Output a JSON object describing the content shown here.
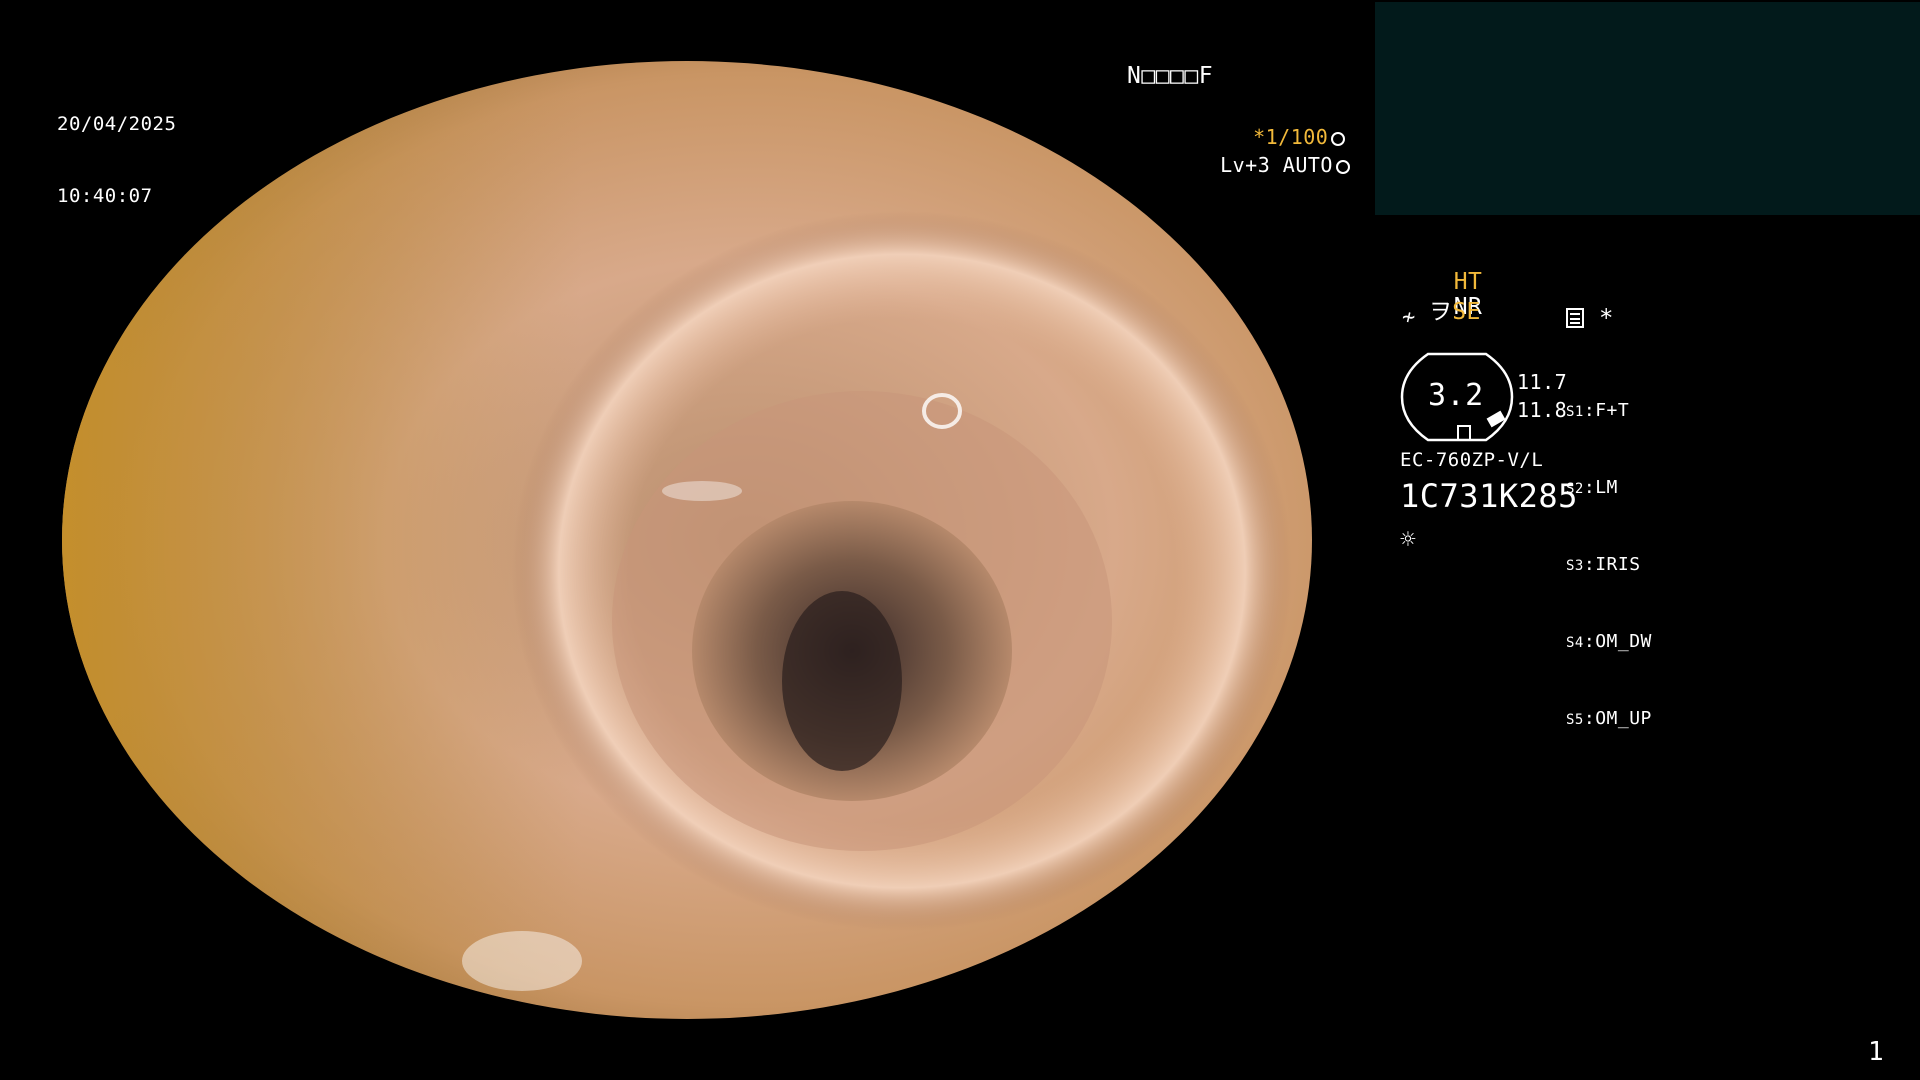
{
  "datetime": {
    "date": "20/04/2025",
    "time": "10:40:07"
  },
  "patient_code": "N□□□□F",
  "shutter": {
    "value": "*1/100",
    "icon": "aperture-icon"
  },
  "iris": {
    "value": "Lv+3 AUTO",
    "icon": "iris-icon"
  },
  "modes": {
    "ht": "HT",
    "nr": "NR",
    "se": "SE"
  },
  "icons": {
    "filter": "filter-icon",
    "scope": "scope-shape-icon",
    "memory": "memory-icon",
    "star": "*",
    "light": "light-sun-icon"
  },
  "scope": {
    "gauge_value": "3.2",
    "reading_1": "11.7",
    "reading_2": "11.8",
    "model": "EC-760ZP-V/L",
    "serial": "1C731K285"
  },
  "switches": [
    {
      "key": "S1",
      "value": "F+T"
    },
    {
      "key": "S2",
      "value": "LM"
    },
    {
      "key": "S3",
      "value": "IRIS"
    },
    {
      "key": "S4",
      "value": "OM_DW"
    },
    {
      "key": "S5",
      "value": "OM_UP"
    }
  ],
  "page_number": "1",
  "colors": {
    "accent": "#f2b93a",
    "panel": "#021a1b",
    "background": "#000000"
  }
}
